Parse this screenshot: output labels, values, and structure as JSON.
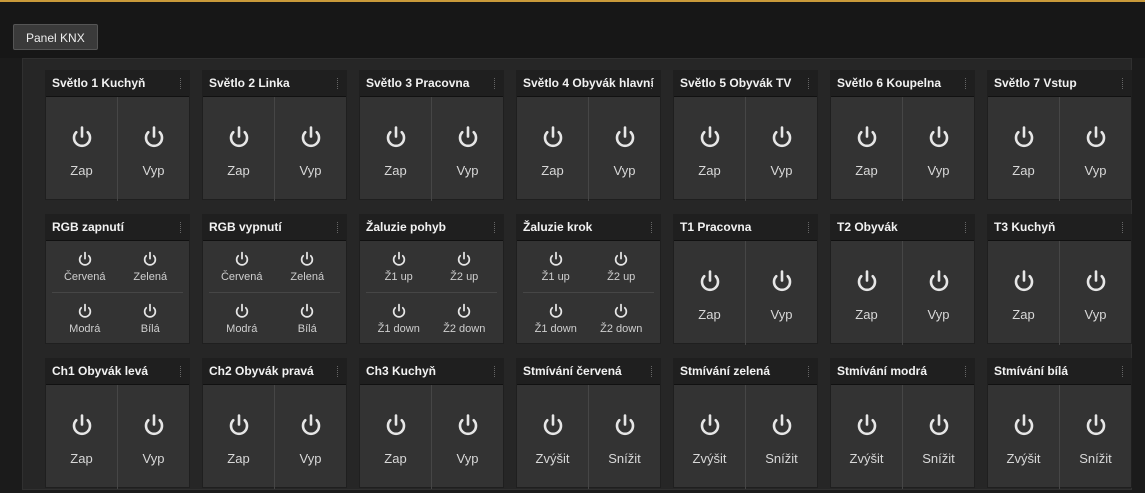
{
  "header": {
    "tab_label": "Panel KNX"
  },
  "icons": {
    "power": "power-icon"
  },
  "colors": {
    "accent": "#c99a3a"
  },
  "rows": [
    [
      {
        "title": "Světlo 1 Kuchyň",
        "type": "two",
        "buttons": [
          "Zap",
          "Vyp"
        ]
      },
      {
        "title": "Světlo 2 Linka",
        "type": "two",
        "buttons": [
          "Zap",
          "Vyp"
        ]
      },
      {
        "title": "Světlo 3 Pracovna",
        "type": "two",
        "buttons": [
          "Zap",
          "Vyp"
        ]
      },
      {
        "title": "Světlo 4 Obyvák hlavní",
        "type": "two",
        "buttons": [
          "Zap",
          "Vyp"
        ]
      },
      {
        "title": "Světlo 5 Obyvák TV",
        "type": "two",
        "buttons": [
          "Zap",
          "Vyp"
        ]
      },
      {
        "title": "Světlo 6 Koupelna",
        "type": "two",
        "buttons": [
          "Zap",
          "Vyp"
        ]
      },
      {
        "title": "Světlo 7 Vstup",
        "type": "two",
        "buttons": [
          "Zap",
          "Vyp"
        ]
      }
    ],
    [
      {
        "title": "RGB zapnutí",
        "type": "four",
        "buttons": [
          "Červená",
          "Zelená",
          "Modrá",
          "Bílá"
        ]
      },
      {
        "title": "RGB vypnutí",
        "type": "four",
        "buttons": [
          "Červená",
          "Zelená",
          "Modrá",
          "Bílá"
        ]
      },
      {
        "title": "Žaluzie pohyb",
        "type": "four",
        "buttons": [
          "Ž1 up",
          "Ž2 up",
          "Ž1 down",
          "Ž2 down"
        ]
      },
      {
        "title": "Žaluzie krok",
        "type": "four",
        "buttons": [
          "Ž1 up",
          "Ž2 up",
          "Ž1 down",
          "Ž2 down"
        ]
      },
      {
        "title": "T1 Pracovna",
        "type": "two",
        "buttons": [
          "Zap",
          "Vyp"
        ]
      },
      {
        "title": "T2 Obyvák",
        "type": "two",
        "buttons": [
          "Zap",
          "Vyp"
        ]
      },
      {
        "title": "T3 Kuchyň",
        "type": "two",
        "buttons": [
          "Zap",
          "Vyp"
        ]
      }
    ],
    [
      {
        "title": "Ch1 Obyvák levá",
        "type": "two",
        "buttons": [
          "Zap",
          "Vyp"
        ]
      },
      {
        "title": "Ch2 Obyvák pravá",
        "type": "two",
        "buttons": [
          "Zap",
          "Vyp"
        ]
      },
      {
        "title": "Ch3 Kuchyň",
        "type": "two",
        "buttons": [
          "Zap",
          "Vyp"
        ]
      },
      {
        "title": "Stmívání červená",
        "type": "two",
        "buttons": [
          "Zvýšit",
          "Snížit"
        ]
      },
      {
        "title": "Stmívání zelená",
        "type": "two",
        "buttons": [
          "Zvýšit",
          "Snížit"
        ]
      },
      {
        "title": "Stmívání modrá",
        "type": "two",
        "buttons": [
          "Zvýšit",
          "Snížit"
        ]
      },
      {
        "title": "Stmívání bílá",
        "type": "two",
        "buttons": [
          "Zvýšit",
          "Snížit"
        ]
      }
    ]
  ]
}
